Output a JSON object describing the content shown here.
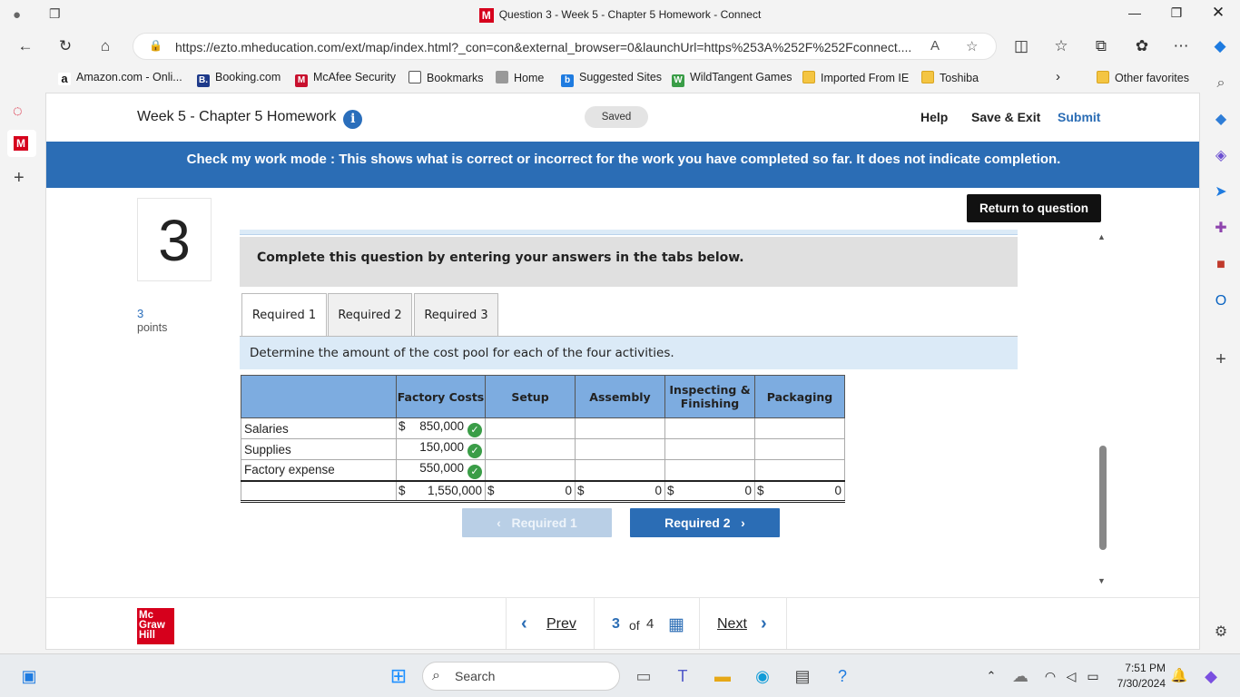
{
  "window": {
    "title": "Question 3 - Week 5 - Chapter 5 Homework - Connect",
    "logo_letter": "M"
  },
  "browser": {
    "url": "https://ezto.mheducation.com/ext/map/index.html?_con=con&external_browser=0&launchUrl=https%253A%252F%252Fconnect....",
    "favorites": [
      "Amazon.com - Onli...",
      "Booking.com",
      "McAfee Security",
      "Bookmarks",
      "Home",
      "Suggested Sites",
      "WildTangent Games",
      "Imported From IE",
      "Toshiba"
    ],
    "other_favorites": "Other favorites"
  },
  "header": {
    "title": "Week 5 - Chapter 5 Homework",
    "saved": "Saved",
    "help": "Help",
    "save_exit": "Save & Exit",
    "submit": "Submit"
  },
  "banner": "Check my work mode : This shows what is correct or incorrect for the work you have completed so far. It does not indicate completion.",
  "question": {
    "number": "3",
    "points": "3",
    "points_label": "points",
    "return_label": "Return to question"
  },
  "instructions": "Complete this question by entering your answers in the tabs below.",
  "tabs": [
    "Required 1",
    "Required 2",
    "Required 3"
  ],
  "directive": "Determine the amount of the cost pool for each of the four activities.",
  "table": {
    "headers": [
      "",
      "Factory Costs",
      "Setup",
      "Assembly",
      "Inspecting & Finishing",
      "Packaging"
    ],
    "rows": [
      {
        "label": "Salaries",
        "cur": "$",
        "factory": "850,000"
      },
      {
        "label": "Supplies",
        "cur": "",
        "factory": "150,000"
      },
      {
        "label": "Factory expense",
        "cur": "",
        "factory": "550,000"
      }
    ],
    "total": {
      "factory": "1,550,000",
      "setup": "0",
      "assembly": "0",
      "inspecting": "0",
      "packaging": "0",
      "cur": "$"
    }
  },
  "nav_buttons": {
    "prev": "Required 1",
    "next": "Required 2"
  },
  "footer": {
    "logo": [
      "Mc",
      "Graw",
      "Hill"
    ],
    "prev": "Prev",
    "current": "3",
    "of": "of",
    "total": "4",
    "next": "Next"
  },
  "taskbar": {
    "search": "Search",
    "time": "7:51 PM",
    "date": "7/30/2024"
  }
}
